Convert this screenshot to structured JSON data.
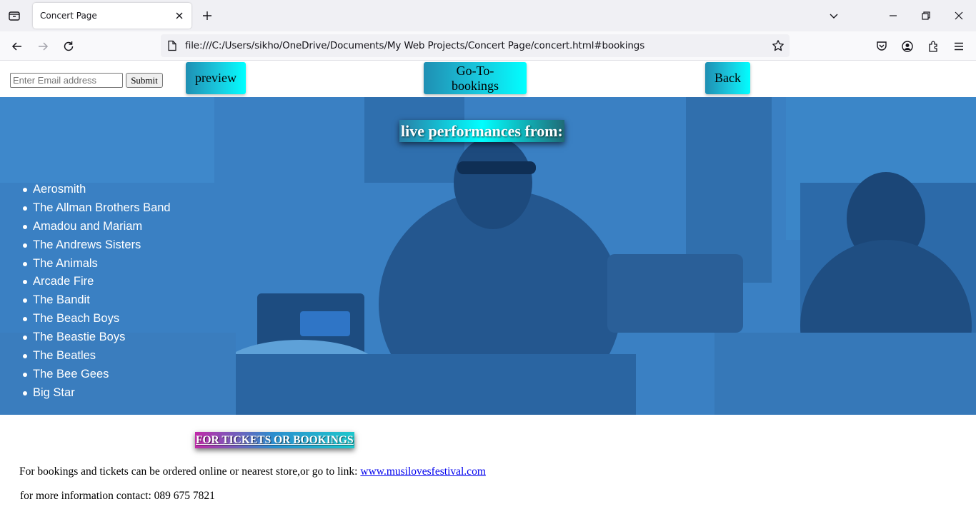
{
  "browser": {
    "tab_title": "Concert Page",
    "url": "file:///C:/Users/sikho/OneDrive/Documents/My Web Projects/Concert Page/concert.html#bookings"
  },
  "form": {
    "email_placeholder": "Enter Email address",
    "email_value": "",
    "submit_label": "Submit"
  },
  "nav": {
    "preview_label": "preview",
    "bookings_label": "Go-To-bookings",
    "back_label": "Back"
  },
  "hero": {
    "title": "live performances from:",
    "bands": [
      "Aerosmith",
      "The Allman Brothers Band",
      "Amadou and Mariam",
      "The Andrews Sisters",
      "The Animals",
      "Arcade Fire",
      "The Bandit",
      "The Beach Boys",
      "The Beastie Boys",
      "The Beatles",
      "The Bee Gees",
      "Big Star"
    ]
  },
  "bookings": {
    "heading": "FOR TICKETS OR BOOKINGS",
    "text": "For bookings and tickets can be ordered online or nearest store,or go to link: ",
    "link_text": "www.musilovesfestival.com",
    "contact_text": "for more information contact: 089 675 7821"
  },
  "colors": {
    "hero_tint": "#3a7fc2",
    "button_gradient_start": "#1f8fb3",
    "button_gradient_end": "#00ffff",
    "link": "#0000ee"
  },
  "icons": [
    "tab-list-icon",
    "close-icon",
    "plus-icon",
    "chevron-down-icon",
    "minimize-icon",
    "restore-icon",
    "window-close-icon",
    "back-arrow-icon",
    "forward-arrow-icon",
    "reload-icon",
    "page-icon",
    "star-icon",
    "pocket-icon",
    "account-icon",
    "extensions-icon",
    "menu-icon"
  ]
}
